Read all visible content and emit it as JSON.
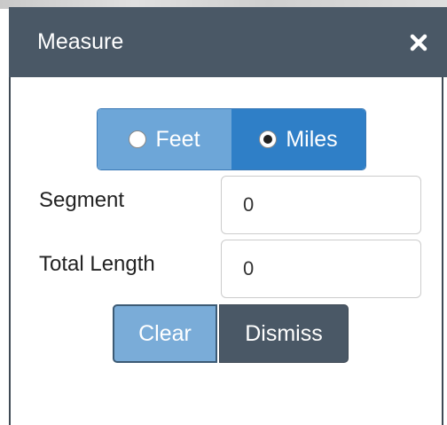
{
  "dialog": {
    "title": "Measure",
    "close_icon": "close-icon"
  },
  "units": {
    "options": [
      {
        "label": "Feet",
        "selected": false
      },
      {
        "label": "Miles",
        "selected": true
      }
    ]
  },
  "fields": {
    "segment_label": "Segment",
    "segment_value": "0",
    "total_label": "Total Length",
    "total_value": "0"
  },
  "buttons": {
    "clear_label": "Clear",
    "dismiss_label": "Dismiss"
  },
  "colors": {
    "header": "#4a5866",
    "selected_unit": "#2f7fc7",
    "unselected_unit": "#6da6d8",
    "clear_button": "#7aacd8",
    "dismiss_button": "#4a5866"
  }
}
